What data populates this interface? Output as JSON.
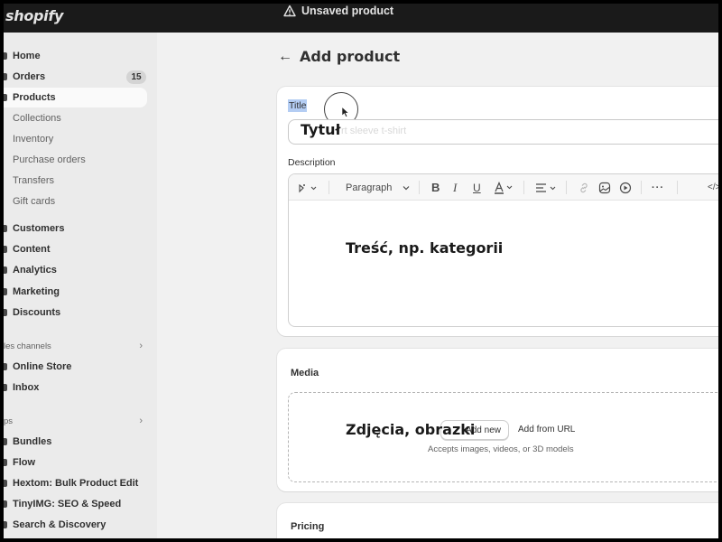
{
  "topbar": {
    "logo": "shopify",
    "status": "Unsaved product",
    "status_icon": "warning-triangle-icon"
  },
  "sidebar": {
    "items": [
      {
        "label": "Home",
        "icon": "home-icon"
      },
      {
        "label": "Orders",
        "icon": "orders-icon",
        "badge": "15"
      },
      {
        "label": "Products",
        "icon": "tag-icon",
        "active": true
      },
      {
        "label": "Collections"
      },
      {
        "label": "Inventory"
      },
      {
        "label": "Purchase orders"
      },
      {
        "label": "Transfers"
      },
      {
        "label": "Gift cards"
      },
      {
        "label": "Customers",
        "icon": "person-icon"
      },
      {
        "label": "Content",
        "icon": "content-icon"
      },
      {
        "label": "Analytics",
        "icon": "chart-icon"
      },
      {
        "label": "Marketing",
        "icon": "target-icon"
      },
      {
        "label": "Discounts",
        "icon": "discount-icon"
      }
    ],
    "sales_channels": {
      "label": "les channels",
      "items": [
        {
          "label": "Online Store",
          "icon": "store-icon"
        },
        {
          "label": "Inbox",
          "icon": "inbox-icon"
        }
      ]
    },
    "apps": {
      "label": "ps",
      "items": [
        {
          "label": "Bundles"
        },
        {
          "label": "Flow"
        },
        {
          "label": "Hextom: Bulk Product Edit"
        },
        {
          "label": "TinyIMG: SEO & Speed"
        },
        {
          "label": "Search & Discovery"
        }
      ]
    }
  },
  "main": {
    "back_icon": "arrow-left-icon",
    "title": "Add product",
    "title_field": {
      "label": "Title",
      "placeholder": "rt sleeve t-shirt"
    },
    "description": {
      "label": "Description",
      "toolbar": {
        "paragraph_label": "Paragraph",
        "icons": [
          "magic-icon",
          "bold-icon",
          "italic-icon",
          "underline-icon",
          "text-color-icon",
          "align-icon",
          "link-icon",
          "image-icon",
          "video-icon",
          "more-icon",
          "code-icon"
        ]
      }
    },
    "media": {
      "label": "Media",
      "upload_button": "Add new",
      "from_url": "Add from URL",
      "accepts": "Accepts images, videos, or 3D models"
    },
    "pricing": {
      "label": "Pricing"
    }
  },
  "overlays": {
    "title": "Tytuł",
    "description": "Treść, np. kategorii",
    "media": "Zdjęcia, obrazki"
  },
  "colors": {
    "topbar": "#1a1a1a",
    "sidebar": "#ebebeb",
    "page": "#f1f1f1",
    "selection": "#b4cdf3"
  }
}
